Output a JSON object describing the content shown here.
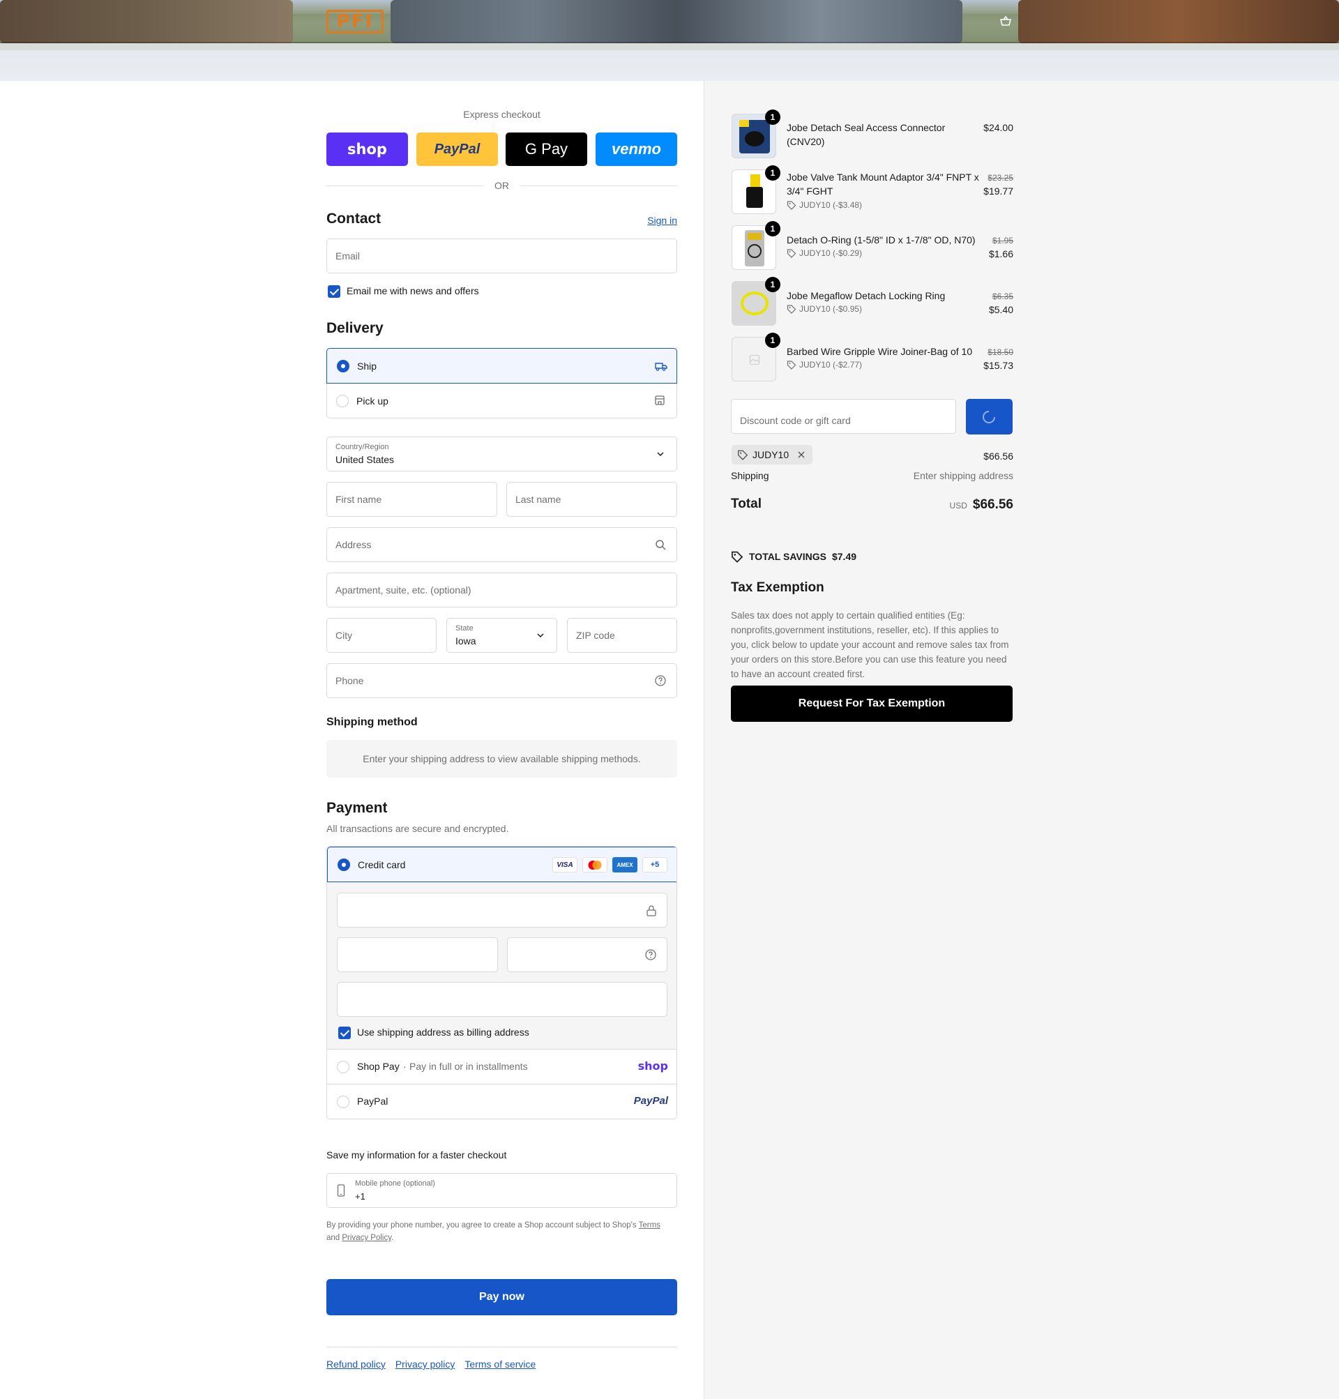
{
  "header": {
    "logo_text": "PFI"
  },
  "express": {
    "label": "Express checkout",
    "buttons": [
      {
        "label": "shop",
        "bg": "#5a31f4"
      },
      {
        "label": "PayPal",
        "bg": "#ffc439"
      },
      {
        "label": "G Pay",
        "bg": "#000000"
      },
      {
        "label": "venmo",
        "bg": "#008cff"
      }
    ],
    "or": "OR"
  },
  "contact": {
    "title": "Contact",
    "sign_in": "Sign in",
    "email_placeholder": "Email",
    "news_label": "Email me with news and offers"
  },
  "delivery": {
    "title": "Delivery",
    "options": [
      {
        "label": "Ship"
      },
      {
        "label": "Pick up"
      }
    ],
    "country_label": "Country/Region",
    "country_value": "United States",
    "first_name": "First name",
    "last_name": "Last name",
    "address": "Address",
    "apartment": "Apartment, suite, etc. (optional)",
    "city": "City",
    "state_label": "State",
    "state_value": "Iowa",
    "zip": "ZIP code",
    "phone": "Phone"
  },
  "shipping_method": {
    "title": "Shipping method",
    "message": "Enter your shipping address to view available shipping methods."
  },
  "payment": {
    "title": "Payment",
    "subtitle": "All transactions are secure and encrypted.",
    "credit_card": "Credit card",
    "cards": [
      "VISA",
      "MC",
      "AMEX",
      "+5"
    ],
    "billing_label": "Use shipping address as billing address",
    "shop_pay": "Shop Pay",
    "shop_pay_note": "Pay in full or in installments",
    "shop_logo": "shop",
    "paypal": "PayPal",
    "paypal_logo": "PayPal"
  },
  "save_info": {
    "title": "Save my information for a faster checkout",
    "mobile_label": "Mobile phone (optional)",
    "mobile_value": "+1",
    "legal_prefix": "By providing your phone number, you agree to create a Shop account subject to Shop's",
    "terms": "Terms",
    "and": "and",
    "privacy": "Privacy Policy",
    "period": "."
  },
  "pay_button": "Pay now",
  "footer_links": [
    "Refund policy",
    "Privacy policy",
    "Terms of service"
  ],
  "items": [
    {
      "qty": "1",
      "name": "Jobe Detach Seal Access Connector (CNV20)",
      "price": "$24.00"
    },
    {
      "qty": "1",
      "name": "Jobe Valve Tank Mount Adaptor 3/4\" FNPT x 3/4\" FGHT",
      "discount": "JUDY10 (-$3.48)",
      "old_price": "$23.25",
      "price": "$19.77"
    },
    {
      "qty": "1",
      "name": "Detach O-Ring (1-5/8\" ID x 1-7/8\" OD, N70)",
      "discount": "JUDY10 (-$0.29)",
      "old_price": "$1.95",
      "price": "$1.66"
    },
    {
      "qty": "1",
      "name": "Jobe Megaflow Detach Locking Ring",
      "discount": "JUDY10 (-$0.95)",
      "old_price": "$6.35",
      "price": "$5.40"
    },
    {
      "qty": "1",
      "name": "Barbed Wire Gripple Wire Joiner-Bag of 10",
      "discount": "JUDY10 (-$2.77)",
      "old_price": "$18.50",
      "price": "$15.73"
    }
  ],
  "summary": {
    "discount_placeholder": "Discount code or gift card",
    "code": "JUDY10",
    "subtotal": "$66.56",
    "shipping_label": "Shipping",
    "shipping_value": "Enter shipping address",
    "total_label": "Total",
    "currency": "USD",
    "total": "$66.56",
    "savings_label": "TOTAL SAVINGS",
    "savings_value": "$7.49"
  },
  "tax": {
    "title": "Tax Exemption",
    "text": "Sales tax does not apply to certain qualified entities (Eg: nonprofits,government institutions, reseller, etc). If this applies to you, click below to update your account and remove sales tax from your orders on this store.Before you can use this feature you need to have an account created first.",
    "button": "Request For Tax Exemption"
  },
  "colors": {
    "accent": "#1756c8",
    "panel": "#f5f5f5"
  }
}
